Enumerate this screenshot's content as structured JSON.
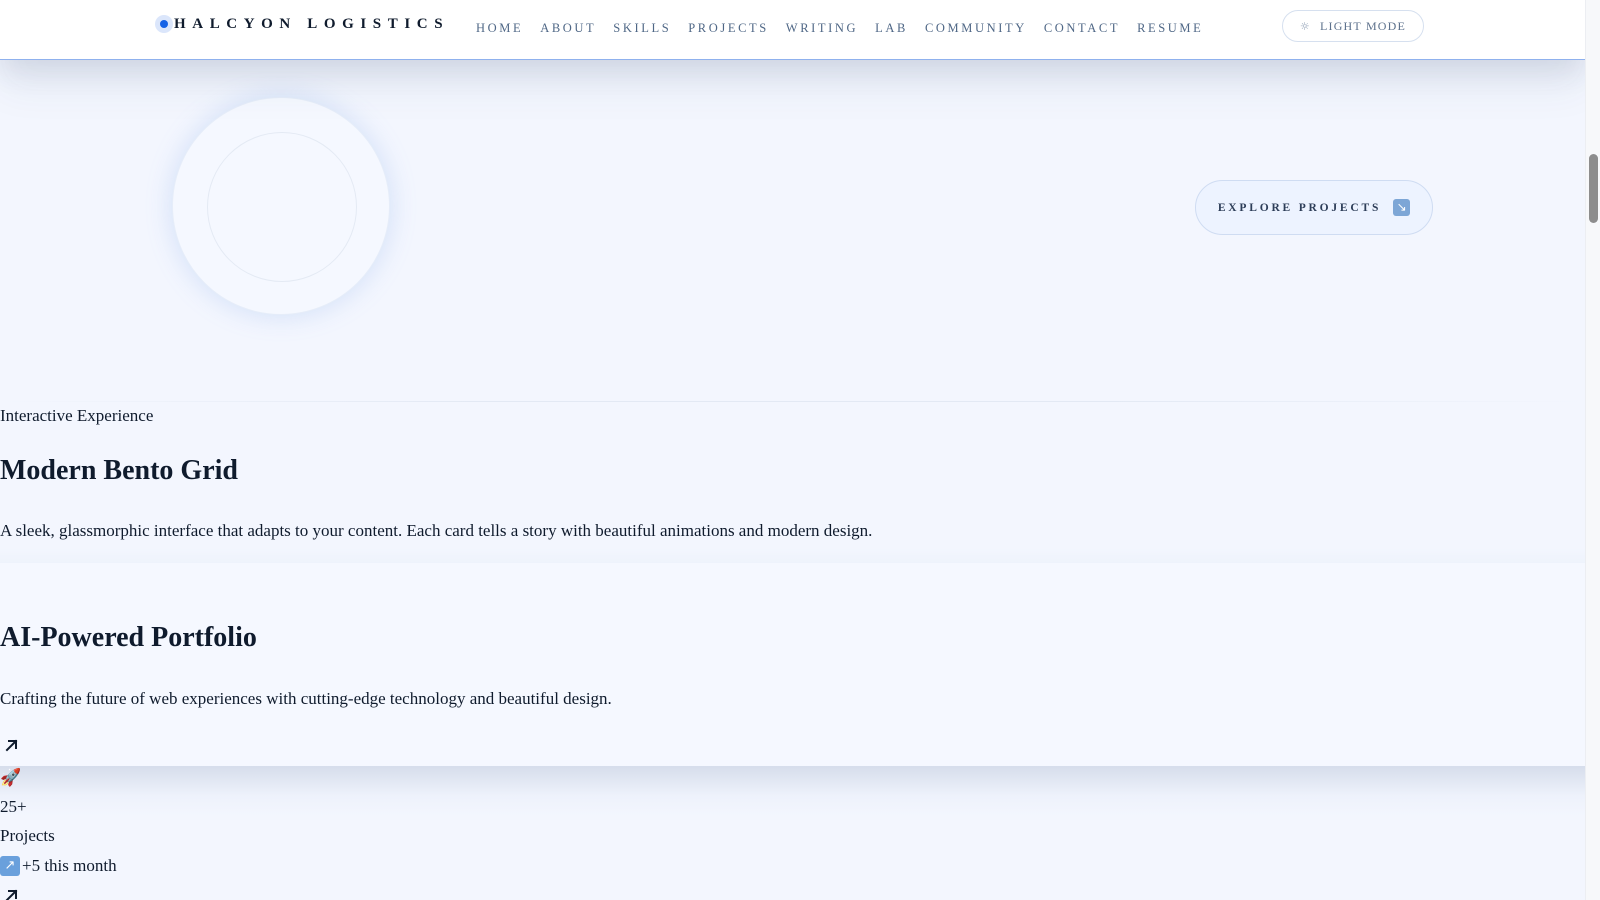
{
  "nav": {
    "brand": "HALCYON LOGISTICS",
    "links": [
      "HOME",
      "ABOUT",
      "SKILLS",
      "PROJECTS",
      "WRITING",
      "LAB",
      "COMMUNITY",
      "CONTACT",
      "RESUME"
    ],
    "mode_icon": "☼",
    "mode_label": "LIGHT MODE"
  },
  "hero": {
    "cta_label": "EXPLORE PROJECTS",
    "cta_icon": "↘"
  },
  "bento": {
    "eyebrow": "Interactive Experience",
    "title": "Modern Bento Grid",
    "description": "A sleek, glassmorphic interface that adapts to your content. Each card tells a story with beautiful animations and modern design."
  },
  "portfolio_card": {
    "title": "AI-Powered Portfolio",
    "description": "Crafting the future of web experiences with cutting-edge technology and beautiful design."
  },
  "stats_card": {
    "icon": "🚀",
    "value": "25+",
    "label": "Projects",
    "trend_icon": "↗",
    "trend_text": "+5 this month"
  },
  "colors": {
    "accent": "#1462e6",
    "background": "#f3f6fe",
    "nav_text": "#4f6786",
    "heading": "#0f1b2d"
  }
}
